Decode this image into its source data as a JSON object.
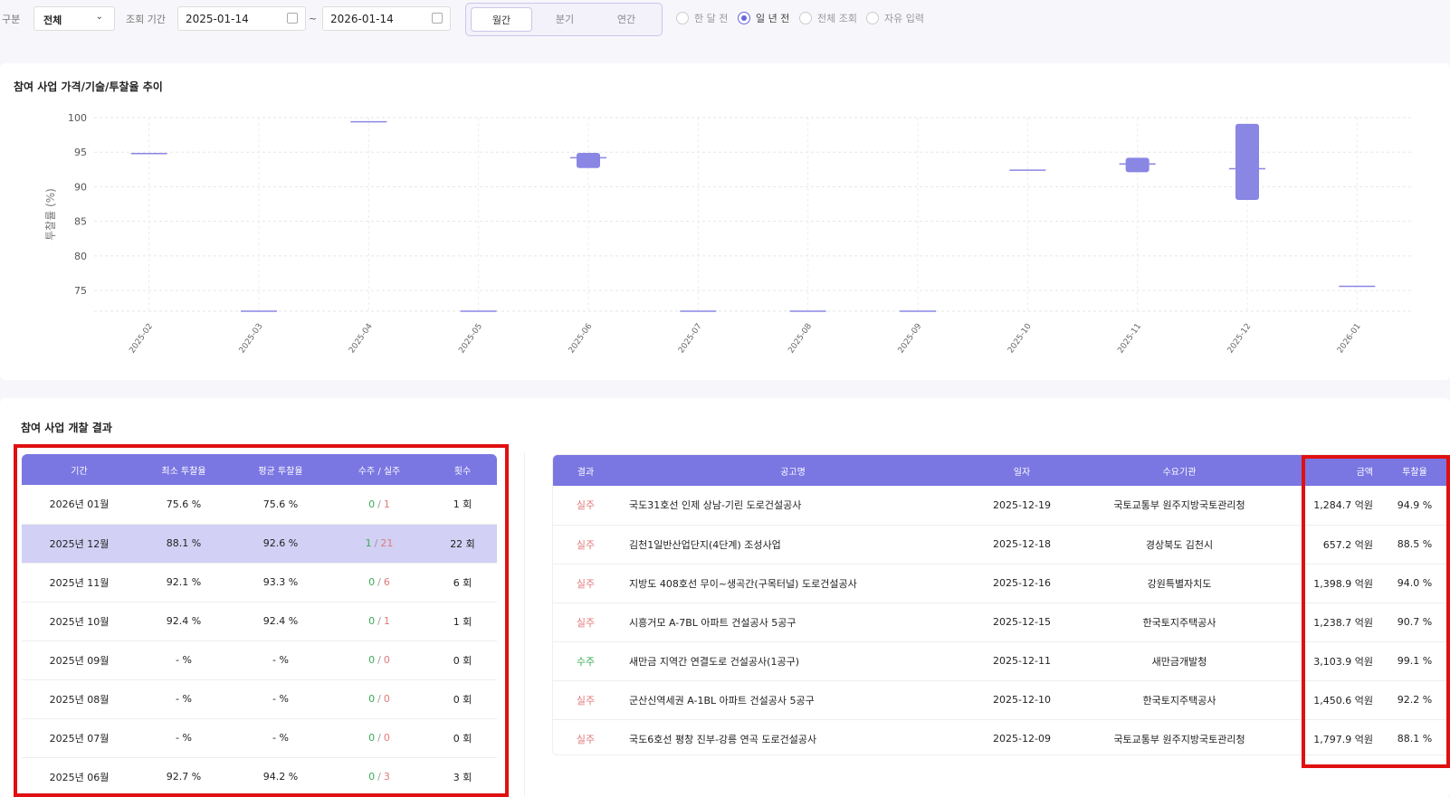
{
  "filter": {
    "category_label": "구분",
    "category_value": "전체",
    "period_label": "조회 기간",
    "date_from": "2025-01-14",
    "date_sep": "~",
    "date_to": "2026-01-14",
    "segments": [
      "월간",
      "분기",
      "연간"
    ],
    "segment_selected": "월간",
    "radios": [
      "한 달 전",
      "일 년 전",
      "전체 조회",
      "자유 입력"
    ],
    "radio_selected": "일 년 전"
  },
  "chart_data": {
    "type": "candlestick",
    "title": "참여 사업 가격/기술/투찰율 추이",
    "ylabel": "투찰률 (%)",
    "ylim": [
      72,
      100
    ],
    "yticks": [
      75,
      80,
      85,
      90,
      95,
      100
    ],
    "categories": [
      "2025-02",
      "2025-03",
      "2025-04",
      "2025-05",
      "2025-06",
      "2025-07",
      "2025-08",
      "2025-09",
      "2025-10",
      "2025-11",
      "2025-12",
      "2026-01"
    ],
    "series": [
      {
        "low": 94.8,
        "high": 94.8,
        "mid": 94.8
      },
      {
        "low": 72.0,
        "high": 72.0,
        "mid": 72.0
      },
      {
        "low": 99.4,
        "high": 99.4,
        "mid": 99.4
      },
      {
        "low": 72.0,
        "high": 72.0,
        "mid": 72.0
      },
      {
        "low": 92.7,
        "high": 94.9,
        "mid": 94.2
      },
      {
        "low": 72.0,
        "high": 72.0,
        "mid": 72.0
      },
      {
        "low": 72.0,
        "high": 72.0,
        "mid": 72.0
      },
      {
        "low": 72.0,
        "high": 72.0,
        "mid": 72.0
      },
      {
        "low": 92.4,
        "high": 92.4,
        "mid": 92.4
      },
      {
        "low": 92.1,
        "high": 94.2,
        "mid": 93.3
      },
      {
        "low": 88.1,
        "high": 99.1,
        "mid": 92.6
      },
      {
        "low": 75.6,
        "high": 75.6,
        "mid": 75.6
      }
    ],
    "color": "#8a86e4",
    "grid": true
  },
  "results": {
    "title": "참여 사업 개찰 결과",
    "summary_headers": [
      "기간",
      "최소 투찰율",
      "평균 투찰율",
      "수주 / 실주",
      "횟수"
    ],
    "summary_rows": [
      {
        "period": "2026년 01월",
        "min": "75.6 %",
        "avg": "75.6 %",
        "win": "0",
        "lose": "1",
        "count": "1 회"
      },
      {
        "period": "2025년 12월",
        "min": "88.1 %",
        "avg": "92.6 %",
        "win": "1",
        "lose": "21",
        "count": "22 회"
      },
      {
        "period": "2025년 11월",
        "min": "92.1 %",
        "avg": "93.3 %",
        "win": "0",
        "lose": "6",
        "count": "6 회"
      },
      {
        "period": "2025년 10월",
        "min": "92.4 %",
        "avg": "92.4 %",
        "win": "0",
        "lose": "1",
        "count": "1 회"
      },
      {
        "period": "2025년 09월",
        "min": "- %",
        "avg": "- %",
        "win": "0",
        "lose": "0",
        "count": "0 회"
      },
      {
        "period": "2025년 08월",
        "min": "- %",
        "avg": "- %",
        "win": "0",
        "lose": "0",
        "count": "0 회"
      },
      {
        "period": "2025년 07월",
        "min": "- %",
        "avg": "- %",
        "win": "0",
        "lose": "0",
        "count": "0 회"
      },
      {
        "period": "2025년 06월",
        "min": "92.7 %",
        "avg": "94.2 %",
        "win": "0",
        "lose": "3",
        "count": "3 회"
      }
    ],
    "slash": "/",
    "detail_headers": [
      "결과",
      "공고명",
      "일자",
      "수요기관",
      "금액",
      "투찰율"
    ],
    "detail_rows": [
      {
        "result": "실주",
        "name": "국도31호선 인제 상남-기린 도로건설공사",
        "date": "2025-12-19",
        "agency": "국토교통부 원주지방국토관리청",
        "amount": "1,284.7 억원",
        "rate": "94.9 %"
      },
      {
        "result": "실주",
        "name": "김천1일반산업단지(4단계) 조성사업",
        "date": "2025-12-18",
        "agency": "경상북도 김천시",
        "amount": "657.2 억원",
        "rate": "88.5 %"
      },
      {
        "result": "실주",
        "name": "지방도 408호선 무이~생곡간(구목터널) 도로건설공사",
        "date": "2025-12-16",
        "agency": "강원특별자치도",
        "amount": "1,398.9 억원",
        "rate": "94.0 %"
      },
      {
        "result": "실주",
        "name": "시흥거모 A-7BL 아파트 건설공사 5공구",
        "date": "2025-12-15",
        "agency": "한국토지주택공사",
        "amount": "1,238.7 억원",
        "rate": "90.7 %"
      },
      {
        "result": "수주",
        "name": "새만금 지역간 연결도로 건설공사(1공구)",
        "date": "2025-12-11",
        "agency": "새만금개발청",
        "amount": "3,103.9 억원",
        "rate": "99.1 %"
      },
      {
        "result": "실주",
        "name": "군산신역세권 A-1BL 아파트 건설공사 5공구",
        "date": "2025-12-10",
        "agency": "한국토지주택공사",
        "amount": "1,450.6 억원",
        "rate": "92.2 %"
      },
      {
        "result": "실주",
        "name": "국도6호선 평창 진부-강릉 연곡 도로건설공사",
        "date": "2025-12-09",
        "agency": "국토교통부 원주지방국토관리청",
        "amount": "1,797.9 억원",
        "rate": "88.1 %"
      }
    ]
  }
}
